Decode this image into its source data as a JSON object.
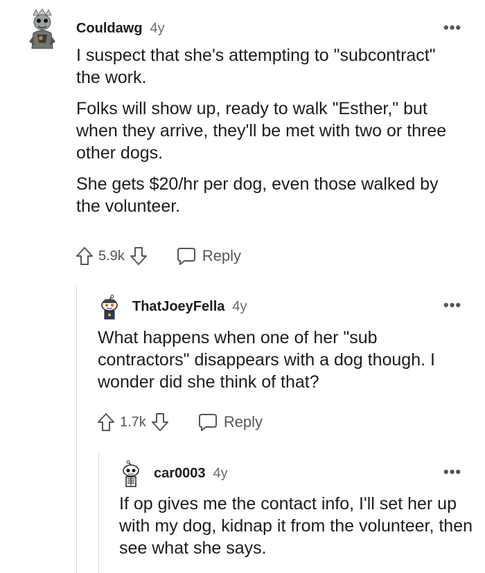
{
  "comments": [
    {
      "username": "Couldawg",
      "time": "4y",
      "more": "•••",
      "paragraphs": [
        "I suspect that she's attempting to \"subcontract\" the work.",
        "Folks will show up, ready to walk \"Esther,\" but when they arrive, they'll be met with two or three other dogs.",
        "She gets $20/hr per dog, even those walked by the volunteer."
      ],
      "votes": "5.9k",
      "reply_label": "Reply"
    },
    {
      "username": "ThatJoeyFella",
      "time": "4y",
      "more": "•••",
      "paragraphs": [
        "What happens when one of her \"sub contractors\" disappears with a dog though. I wonder did she think of that?"
      ],
      "votes": "1.7k",
      "reply_label": "Reply"
    },
    {
      "username": "car0003",
      "time": "4y",
      "more": "•••",
      "paragraphs": [
        "If op gives me the contact info, I'll set her up with my dog, kidnap it from the volunteer, then see what she says."
      ]
    }
  ],
  "icons": {
    "upvote": "upvote-arrow-icon",
    "downvote": "downvote-arrow-icon",
    "reply": "speech-bubble-icon",
    "more": "three-dots-icon"
  }
}
